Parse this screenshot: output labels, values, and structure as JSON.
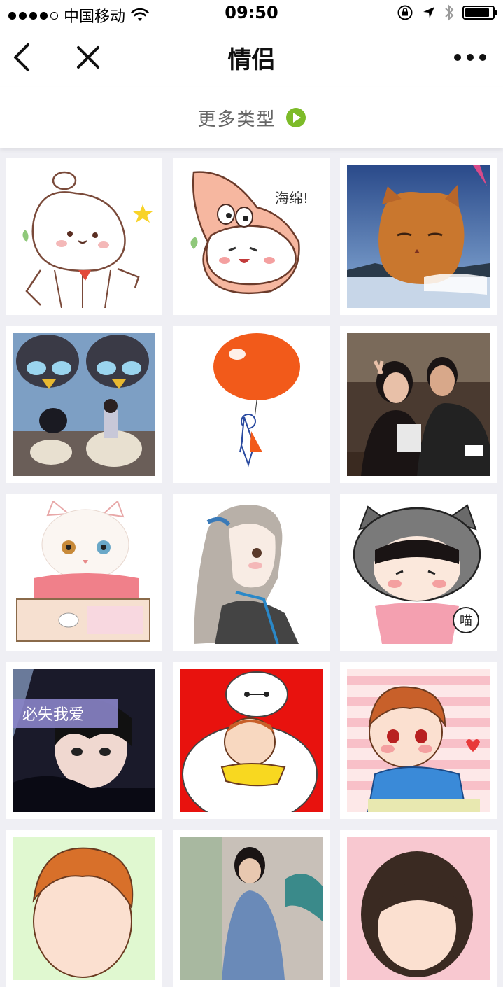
{
  "status_bar": {
    "carrier": "中国移动",
    "time": "09:50"
  },
  "nav": {
    "title": "情侣"
  },
  "more_types": {
    "label": "更多类型"
  },
  "grid_text": {
    "sponge_caption": "海绵!",
    "meow_caption": "喵",
    "boy_photo_caption": "必失我爱"
  },
  "colors": {
    "accent_green": "#7dbb29",
    "background": "#efeff4"
  },
  "icons": [
    "back-arrow-icon",
    "close-icon",
    "more-dots-icon",
    "play-arrow-icon",
    "wifi-icon",
    "rotation-lock-icon",
    "location-icon",
    "bluetooth-icon",
    "battery-icon"
  ]
}
